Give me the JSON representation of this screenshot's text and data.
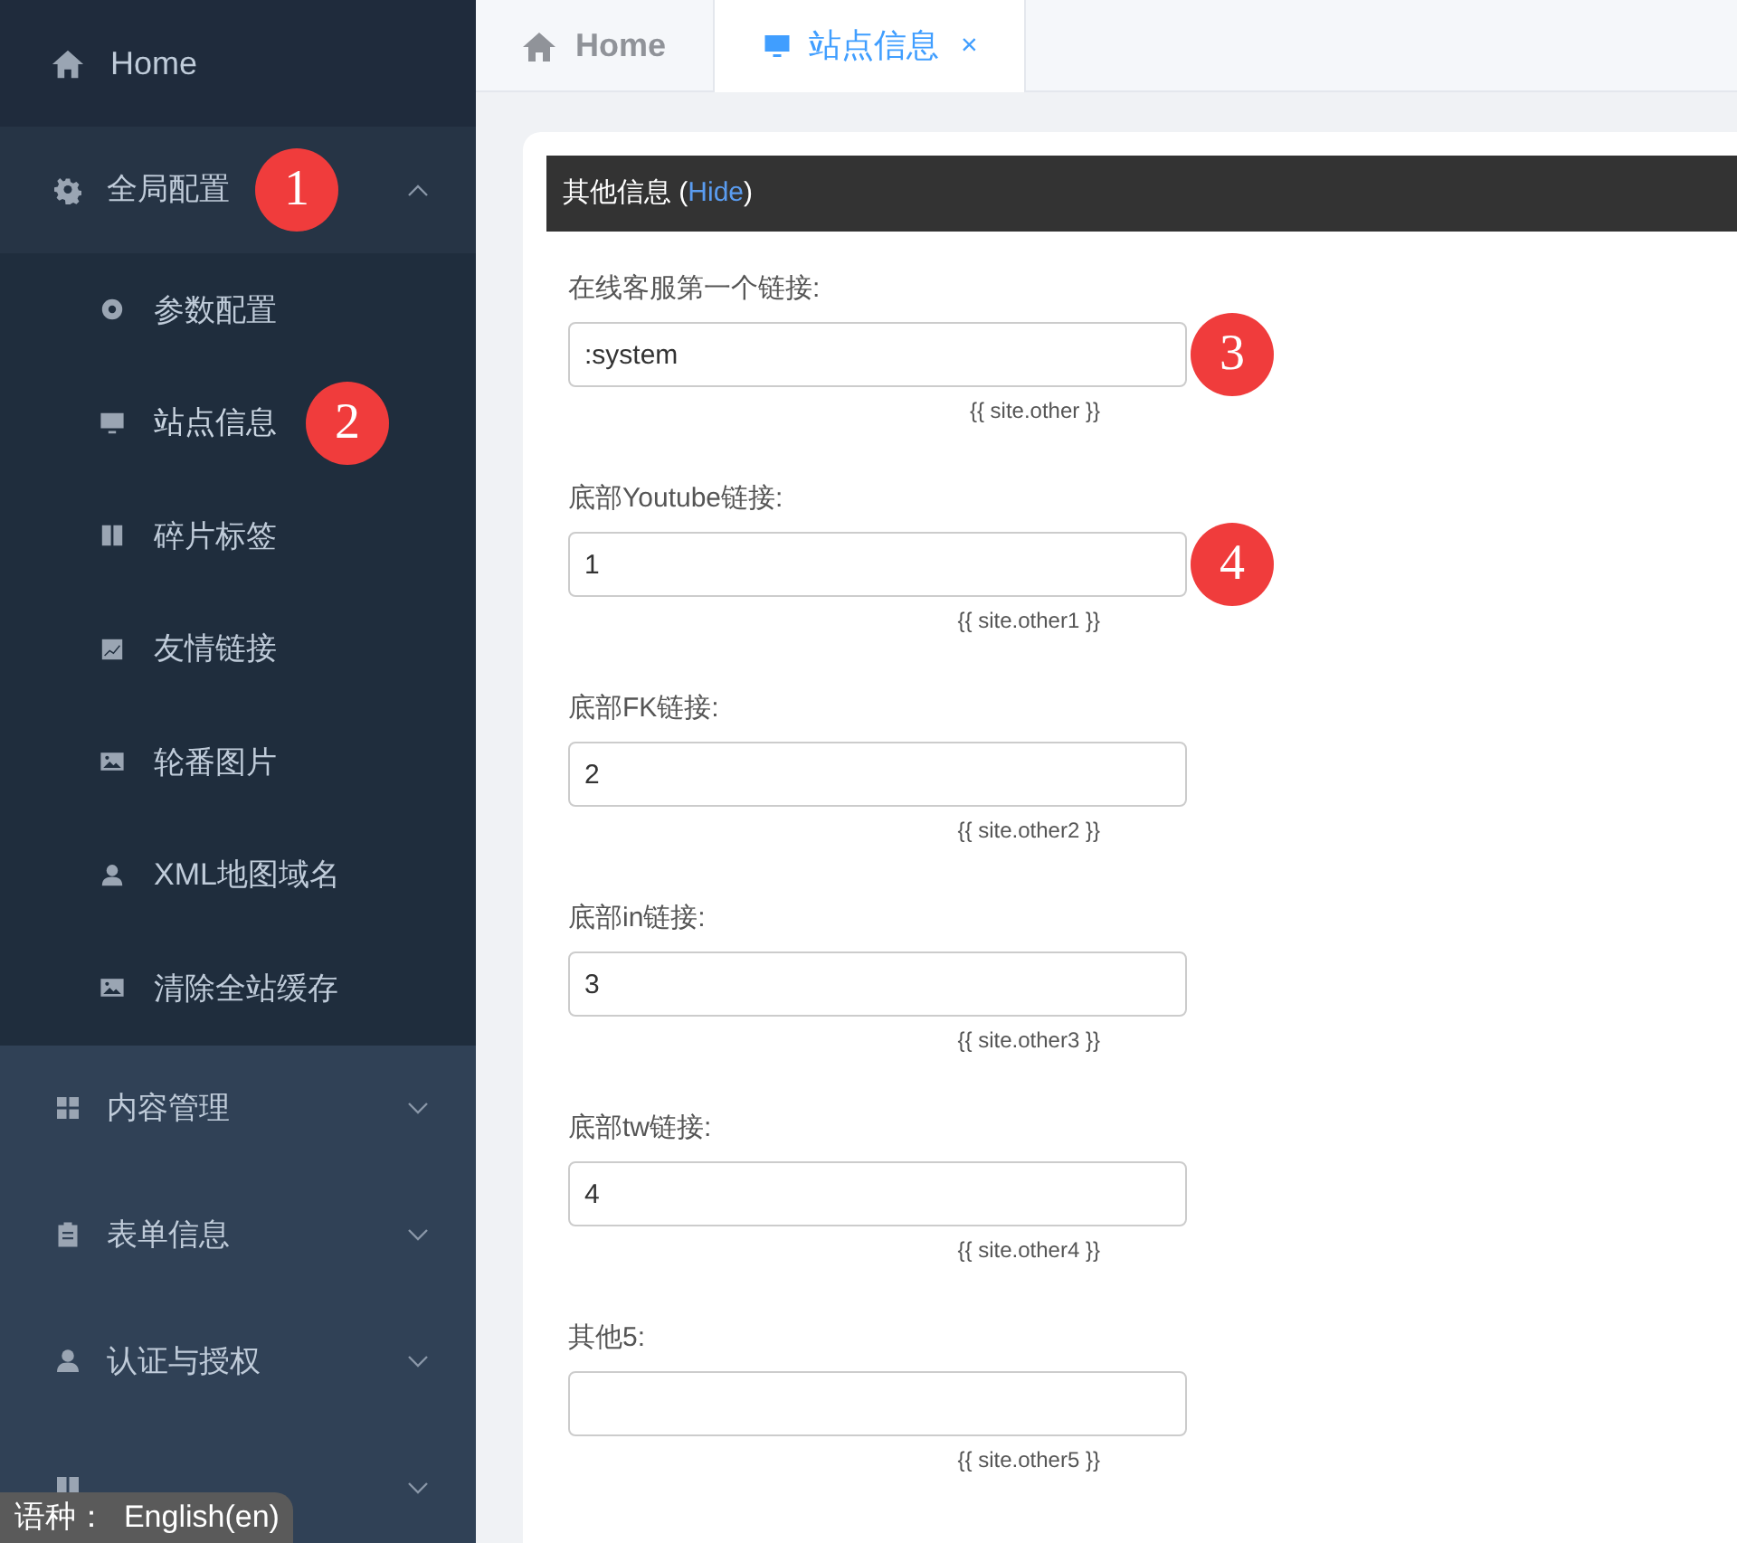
{
  "sidebar": {
    "home": {
      "label": "Home"
    },
    "groups": [
      {
        "label": "全局配置",
        "expanded": true,
        "marker": "1",
        "children": [
          {
            "label": "参数配置",
            "selected": false
          },
          {
            "label": "站点信息",
            "selected": true,
            "marker": "2"
          },
          {
            "label": "碎片标签",
            "selected": false
          },
          {
            "label": "友情链接",
            "selected": false
          },
          {
            "label": "轮番图片",
            "selected": false
          },
          {
            "label": "XML地图域名",
            "selected": false
          },
          {
            "label": "清除全站缓存",
            "selected": false
          }
        ]
      },
      {
        "label": "内容管理",
        "expanded": false
      },
      {
        "label": "表单信息",
        "expanded": false
      },
      {
        "label": "认证与授权",
        "expanded": false
      },
      {
        "expanded": false
      }
    ]
  },
  "language_badge": "语种：  English(en)",
  "tabs": [
    {
      "label": "Home",
      "selected": false
    },
    {
      "label": "站点信息",
      "selected": true,
      "close": "×"
    }
  ],
  "section": {
    "title": "其他信息",
    "open": "(",
    "toggle": "Hide",
    "close": ")"
  },
  "fields": [
    {
      "label": "在线客服第一个链接:",
      "value": ":system",
      "hint": "{{ site.other }}",
      "marker": "3"
    },
    {
      "label": "底部Youtube链接:",
      "value": "1",
      "hint": "{{ site.other1 }}",
      "marker": "4"
    },
    {
      "label": "底部FK链接:",
      "value": "2",
      "hint": "{{ site.other2 }}"
    },
    {
      "label": "底部in链接:",
      "value": "3",
      "hint": "{{ site.other3 }}"
    },
    {
      "label": "底部tw链接:",
      "value": "4",
      "hint": "{{ site.other4 }}"
    },
    {
      "label": "其他5:",
      "hint": "{{ site.other5 }}"
    }
  ]
}
